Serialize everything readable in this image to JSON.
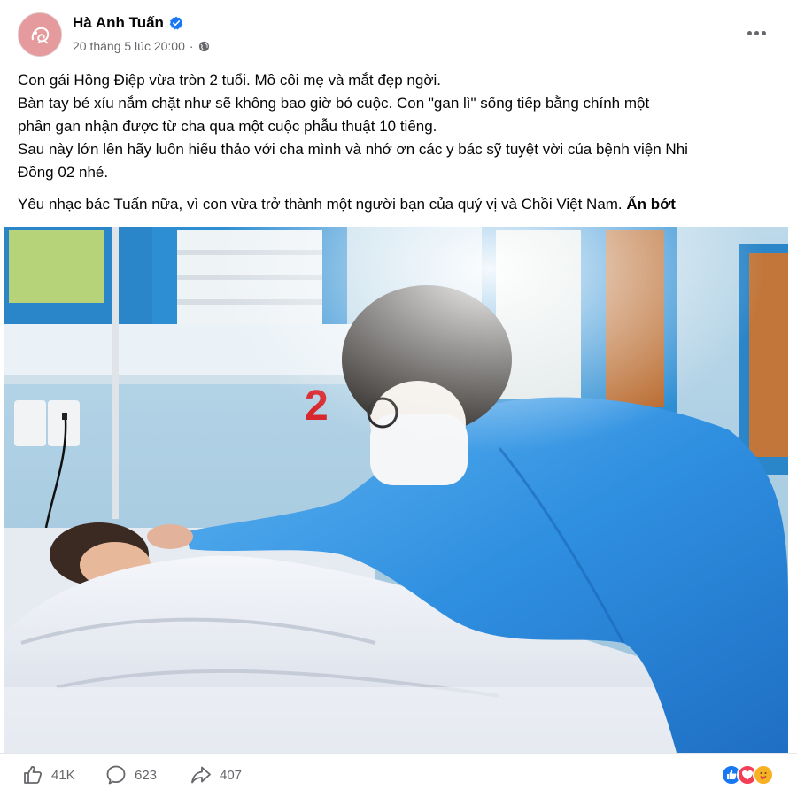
{
  "post": {
    "author": {
      "name": "Hà Anh Tuấn",
      "verified_icon": "verified-badge-icon",
      "avatar_icon": "avatar"
    },
    "timestamp": "20 tháng 5 lúc 20:00",
    "separator": "·",
    "privacy_icon": "globe-icon",
    "more_icon": "more-options-icon",
    "body_lines": [
      "Con gái Hồng Điệp vừa tròn 2 tuổi. Mồ côi mẹ và mắt đẹp ngời.",
      "Bàn tay bé xíu nắm chặt như sẽ không bao giờ bỏ cuộc. Con \"gan lì\" sống tiếp bằng chính một",
      "phần gan nhận được từ cha qua một cuộc phẫu thuật 10 tiếng.",
      "Sau này lớn lên hãy luôn hiếu thảo với cha mình và nhớ ơn các y bác sỹ tuyệt vời của bệnh viện Nhi",
      "Đồng 02 nhé."
    ],
    "body_para2": "Yêu nhạc bác Tuấn nữa, vì con vừa trở thành một người bạn của quý vị và Chồi Việt Nam.",
    "see_less_label": "Ẩn bớt",
    "photo": {
      "room_sign": "2"
    }
  },
  "footer": {
    "like_count": "41K",
    "comment_count": "623",
    "share_count": "407",
    "icons": [
      "like-icon",
      "comment-icon",
      "share-icon"
    ],
    "reactions": [
      "like-reaction-icon",
      "love-reaction-icon",
      "care-reaction-icon"
    ]
  },
  "colors": {
    "accent": "#1877f2",
    "secondary_text": "#65676b",
    "love": "#f33e58",
    "care": "#f7b125",
    "gown_blue": "#2f8fe0"
  }
}
